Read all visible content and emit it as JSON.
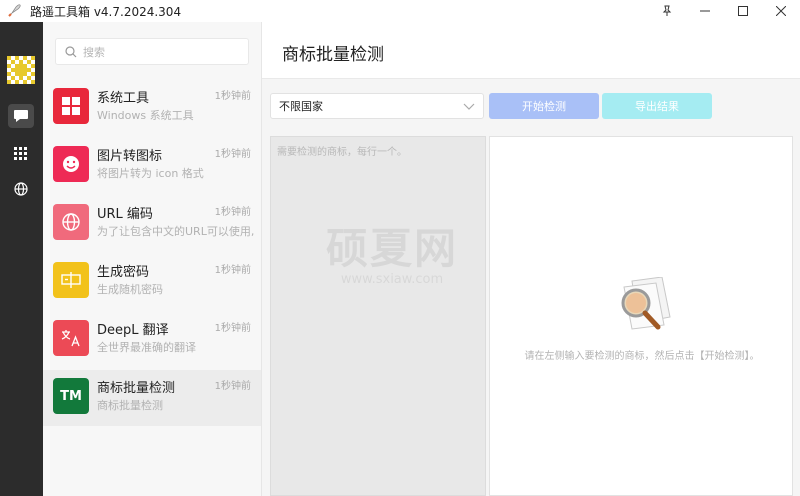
{
  "window": {
    "title": "路遥工具箱 v4.7.2024.304",
    "controls": [
      "pin-icon",
      "minimize-icon",
      "maximize-icon",
      "close-icon"
    ]
  },
  "rail": {
    "items": [
      {
        "icon": "chat-icon",
        "active": true
      },
      {
        "icon": "apps-grid-icon",
        "active": false
      },
      {
        "icon": "globe-icon",
        "active": false
      }
    ]
  },
  "search": {
    "placeholder": "搜索"
  },
  "tools": [
    {
      "name": "系统工具",
      "desc": "Windows 系统工具",
      "time": "1秒钟前",
      "icon": "windows-logo-icon",
      "color": "#e8283b"
    },
    {
      "name": "图片转图标",
      "desc": "将图片转为 icon 格式",
      "time": "1秒钟前",
      "icon": "smiley-icon",
      "color": "#ee2a55"
    },
    {
      "name": "URL 编码",
      "desc": "为了让包含中文的URL可以使用,",
      "time": "1秒钟前",
      "icon": "globe-icon",
      "color": "#f06a7c"
    },
    {
      "name": "生成密码",
      "desc": "生成随机密码",
      "time": "1秒钟前",
      "icon": "password-icon",
      "color": "#f2c21b"
    },
    {
      "name": "DeepL 翻译",
      "desc": "全世界最准确的翻译",
      "time": "1秒钟前",
      "icon": "translate-icon",
      "color": "#ec4a56"
    },
    {
      "name": "商标批量检测",
      "desc": "商标批量检测",
      "time": "1秒钟前",
      "icon": "TM",
      "color": "#12793b"
    }
  ],
  "main": {
    "title": "商标批量检测",
    "country_select": "不限国家",
    "start_button": "开始检测",
    "export_button": "导出结果",
    "input_placeholder": "需要检测的商标，每行一个。",
    "result_hint": "请在左侧输入要检测的商标，然后点击【开始检测】。"
  },
  "watermark": {
    "big": "硕夏网",
    "small": "www.sxiaw.com"
  },
  "colors": {
    "start_button": "#a9c0f7",
    "export_button": "#a5ecf2",
    "rail": "#2c2c2c"
  }
}
